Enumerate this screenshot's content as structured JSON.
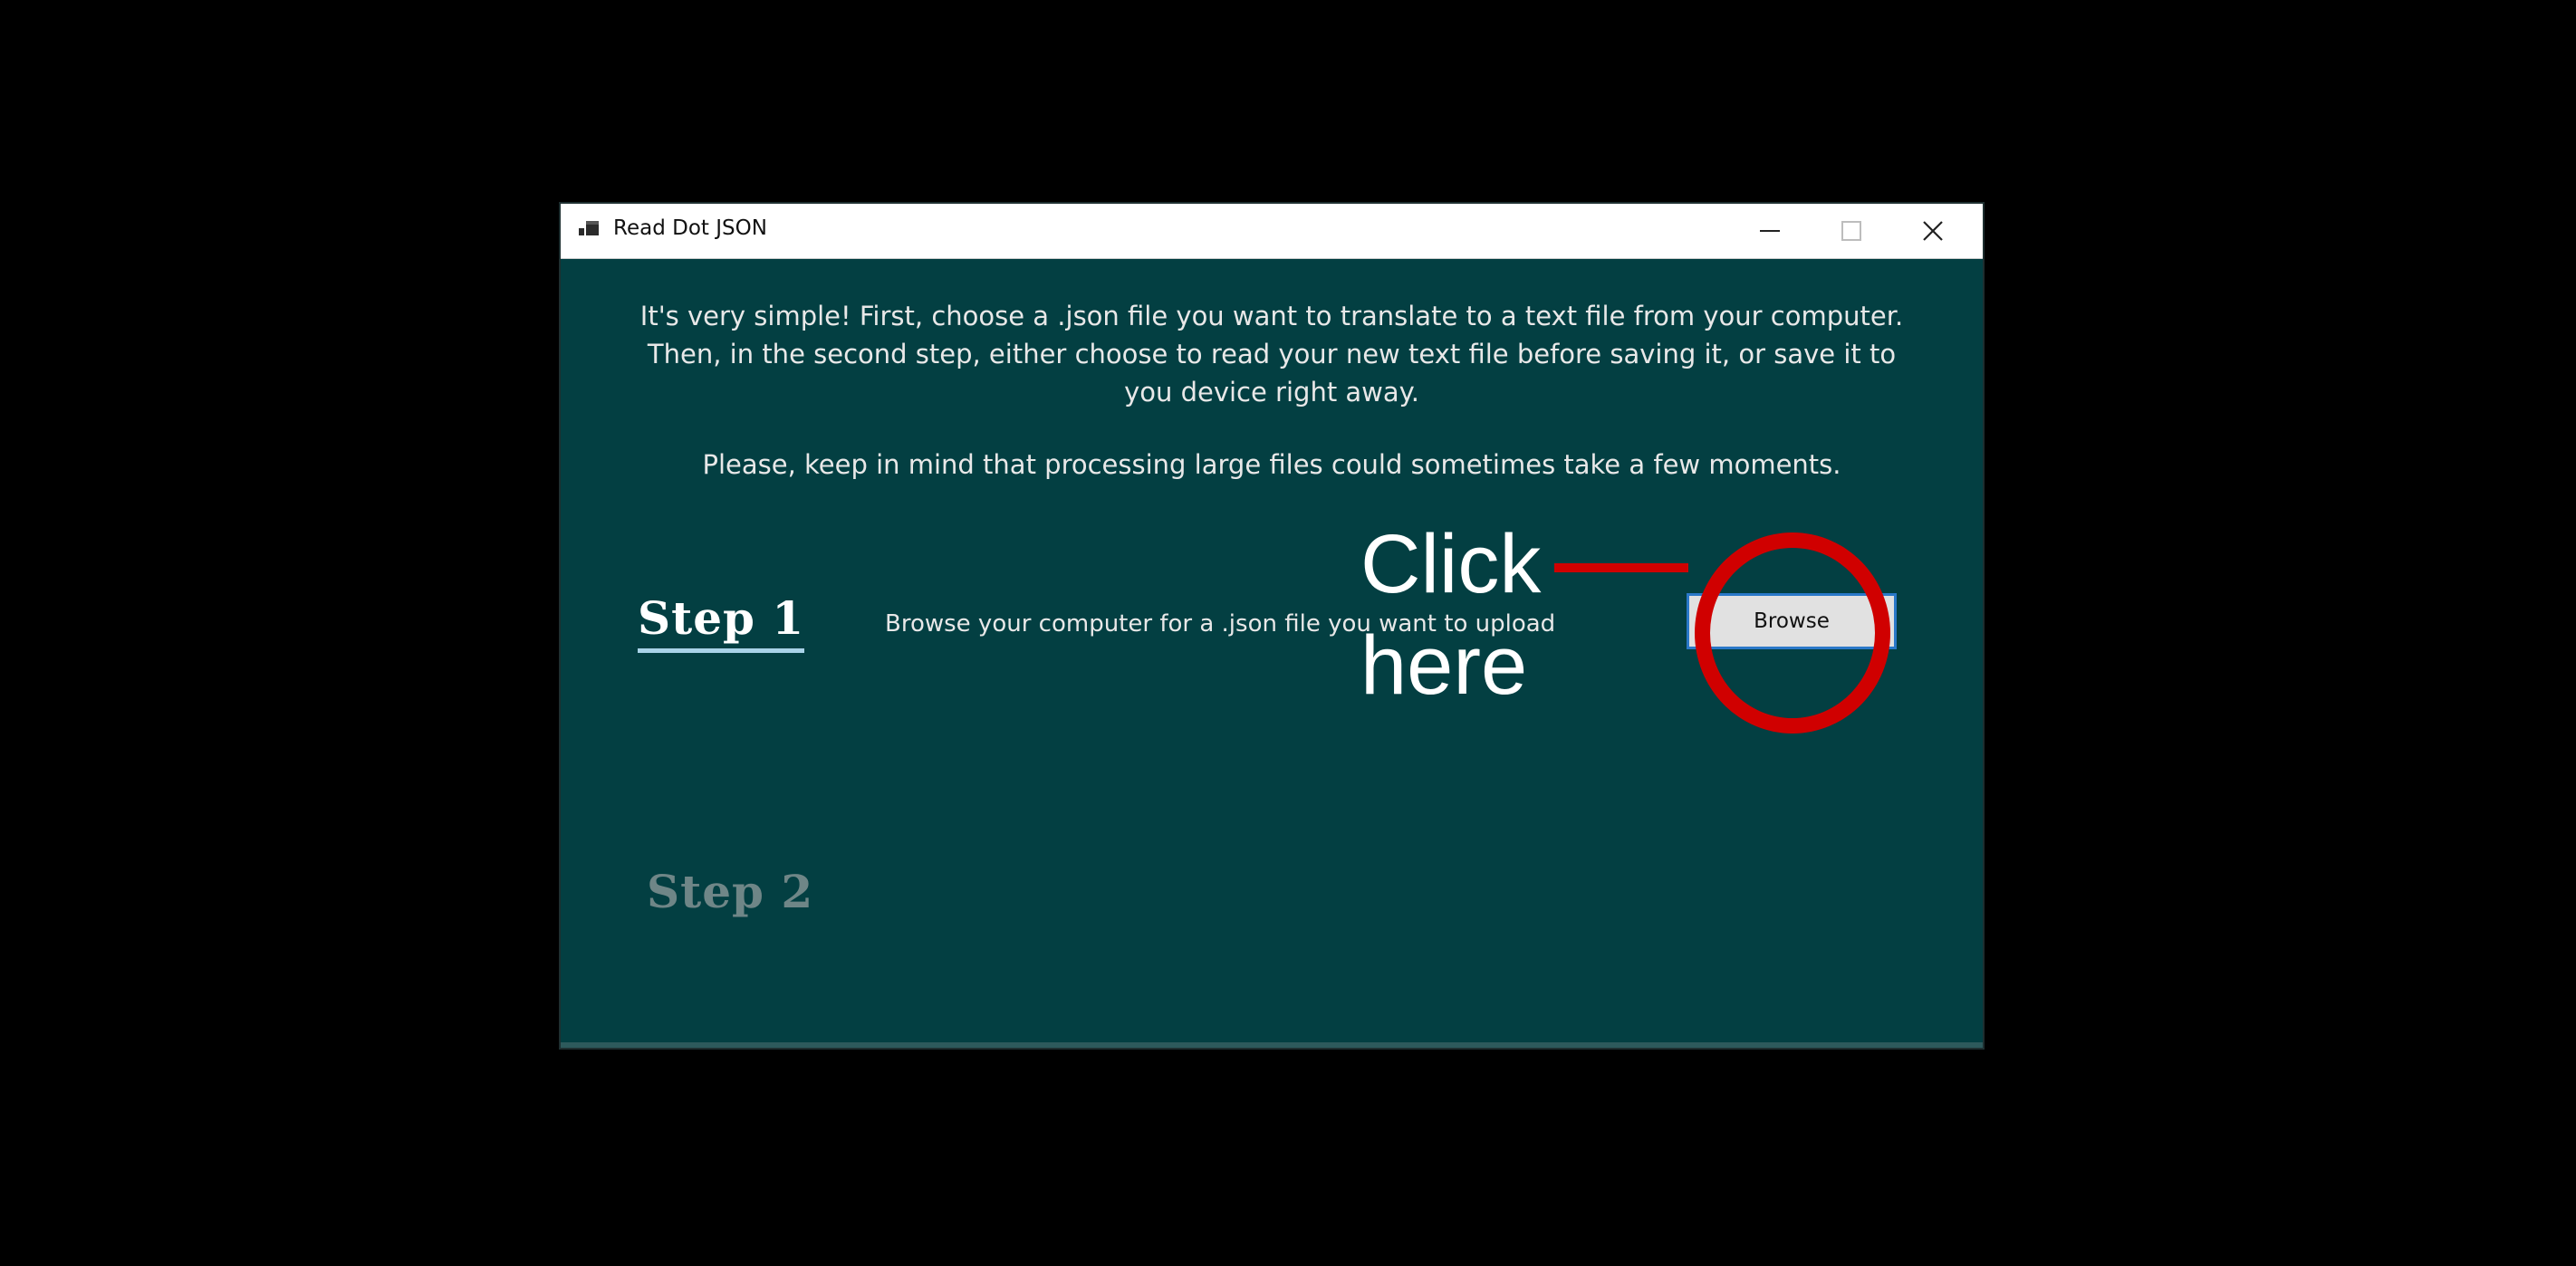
{
  "window": {
    "title": "Read Dot JSON",
    "icon": "app-window-icon"
  },
  "controls": {
    "minimize_icon": "minimize-icon",
    "maximize_icon": "maximize-icon",
    "close_icon": "close-icon"
  },
  "intro": {
    "line1": "It's very simple! First, choose a .json file you want to translate to a text file from your computer.",
    "line2": "Then, in the second step, either choose to read your new text file before saving it, or save it to",
    "line3": "you device right away.",
    "note": "Please, keep in mind that processing large files could sometimes take a few moments."
  },
  "step1": {
    "heading": "Step 1",
    "description": "Browse your computer for a .json file you want to upload",
    "browse_label": "Browse"
  },
  "step2": {
    "heading": "Step 2"
  },
  "annotation": {
    "line1": "Click",
    "line2": "here",
    "color": "#d00000"
  },
  "colors": {
    "window_background": "#033f42",
    "titlebar": "#ffffff",
    "button_border": "#2a78c8",
    "step2_disabled": "#6f8687"
  }
}
